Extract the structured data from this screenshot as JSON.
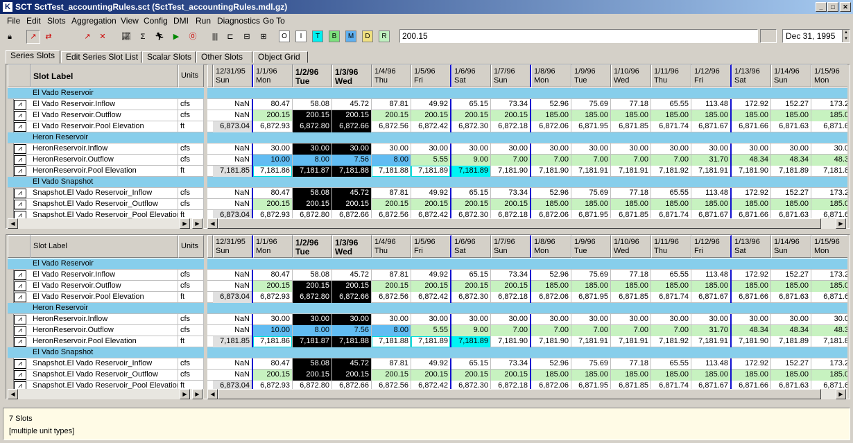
{
  "window": {
    "title": "SCT SctTest_accountingRules.sct (SctTest_accountingRules.mdl.gz)"
  },
  "menu": [
    "File",
    "Edit",
    "Slots",
    "Aggregation",
    "View",
    "Config",
    "DMI",
    "Run",
    "Diagnostics",
    "Go To"
  ],
  "flags": [
    "O",
    "I",
    "T",
    "B",
    "M",
    "D",
    "R"
  ],
  "value_field": "200.15",
  "date_field": "Dec 31, 1995",
  "tabs": [
    "Series Slots",
    "Edit Series Slot List",
    "Scalar Slots",
    "Other Slots",
    "Object Grid"
  ],
  "active_tab": "Series Slots",
  "grid": {
    "slot_label_header": "Slot Label",
    "units_header": "Units",
    "columns": [
      {
        "date": "12/31/95",
        "day": "Sun"
      },
      {
        "date": "1/1/96",
        "day": "Mon"
      },
      {
        "date": "1/2/96",
        "day": "Tue"
      },
      {
        "date": "1/3/96",
        "day": "Wed"
      },
      {
        "date": "1/4/96",
        "day": "Thu"
      },
      {
        "date": "1/5/96",
        "day": "Fri"
      },
      {
        "date": "1/6/96",
        "day": "Sat"
      },
      {
        "date": "1/7/96",
        "day": "Sun"
      },
      {
        "date": "1/8/96",
        "day": "Mon"
      },
      {
        "date": "1/9/96",
        "day": "Tue"
      },
      {
        "date": "1/10/96",
        "day": "Wed"
      },
      {
        "date": "1/11/96",
        "day": "Thu"
      },
      {
        "date": "1/12/96",
        "day": "Fri"
      },
      {
        "date": "1/13/96",
        "day": "Sat"
      },
      {
        "date": "1/14/96",
        "day": "Sun"
      },
      {
        "date": "1/15/96",
        "day": "Mon"
      }
    ],
    "rows": [
      {
        "type": "group",
        "label": "El Vado Reservoir"
      },
      {
        "type": "slot",
        "label": "El Vado Reservoir.Inflow",
        "units": "cfs",
        "values": [
          "NaN",
          "80.47",
          "58.08",
          "45.72",
          "87.81",
          "49.92",
          "65.15",
          "73.34",
          "52.96",
          "75.69",
          "77.18",
          "65.55",
          "113.48",
          "172.92",
          "152.27",
          "173.2"
        ],
        "styles": [
          "",
          "",
          "",
          "",
          "",
          "",
          "",
          "",
          "",
          "",
          "",
          "",
          "",
          "",
          "",
          ""
        ]
      },
      {
        "type": "slot",
        "label": "El Vado Reservoir.Outflow",
        "units": "cfs",
        "values": [
          "NaN",
          "200.15",
          "200.15",
          "200.15",
          "200.15",
          "200.15",
          "200.15",
          "200.15",
          "185.00",
          "185.00",
          "185.00",
          "185.00",
          "185.00",
          "185.00",
          "185.00",
          "185.0"
        ],
        "styles": [
          "",
          "g",
          "k",
          "k",
          "g",
          "g",
          "g",
          "g",
          "g",
          "g",
          "g",
          "g",
          "g",
          "g",
          "g",
          "g"
        ]
      },
      {
        "type": "slot",
        "label": "El Vado Reservoir.Pool Elevation",
        "units": "ft",
        "values": [
          "6,873.04",
          "6,872.93",
          "6,872.80",
          "6,872.66",
          "6,872.56",
          "6,872.42",
          "6,872.30",
          "6,872.18",
          "6,872.06",
          "6,871.95",
          "6,871.85",
          "6,871.74",
          "6,871.67",
          "6,871.66",
          "6,871.63",
          "6,871.6"
        ],
        "styles": [
          "h",
          "",
          "k",
          "k",
          "",
          "",
          "",
          "",
          "",
          "",
          "",
          "",
          "",
          "",
          "",
          ""
        ]
      },
      {
        "type": "group",
        "label": "Heron Reservoir"
      },
      {
        "type": "slot",
        "label": "HeronReservoir.Inflow",
        "units": "cfs",
        "values": [
          "NaN",
          "30.00",
          "30.00",
          "30.00",
          "30.00",
          "30.00",
          "30.00",
          "30.00",
          "30.00",
          "30.00",
          "30.00",
          "30.00",
          "30.00",
          "30.00",
          "30.00",
          "30.0"
        ],
        "styles": [
          "",
          "",
          "k",
          "k",
          "",
          "",
          "",
          "",
          "",
          "",
          "",
          "",
          "",
          "",
          "",
          ""
        ]
      },
      {
        "type": "slot",
        "label": "HeronReservoir.Outflow",
        "units": "cfs",
        "values": [
          "NaN",
          "10.00",
          "8.00",
          "7.56",
          "8.00",
          "5.55",
          "9.00",
          "7.00",
          "7.00",
          "7.00",
          "7.00",
          "7.00",
          "31.70",
          "48.34",
          "48.34",
          "48.3"
        ],
        "styles": [
          "",
          "b",
          "b",
          "b",
          "b",
          "g",
          "g",
          "g",
          "g",
          "g",
          "g",
          "g",
          "g",
          "g",
          "g",
          "g"
        ]
      },
      {
        "type": "slot",
        "label": "HeronReservoir.Pool Elevation",
        "units": "ft",
        "values": [
          "7,181.85",
          "7,181.86",
          "7,181.87",
          "7,181.88",
          "7,181.88",
          "7,181.89",
          "7,181.89",
          "7,181.90",
          "7,181.90",
          "7,181.91",
          "7,181.91",
          "7,181.92",
          "7,181.91",
          "7,181.90",
          "7,181.89",
          "7,181.8"
        ],
        "styles": [
          "h",
          "cx",
          "k",
          "k",
          "cx",
          "cx",
          "c",
          "",
          "",
          "",
          "",
          "",
          "",
          "",
          "",
          ""
        ]
      },
      {
        "type": "group",
        "label": "El Vado Snapshot"
      },
      {
        "type": "slot",
        "label": "Snapshot.El Vado Reservoir_Inflow",
        "units": "cfs",
        "values": [
          "NaN",
          "80.47",
          "58.08",
          "45.72",
          "87.81",
          "49.92",
          "65.15",
          "73.34",
          "52.96",
          "75.69",
          "77.18",
          "65.55",
          "113.48",
          "172.92",
          "152.27",
          "173.2"
        ],
        "styles": [
          "",
          "",
          "k",
          "k",
          "",
          "",
          "",
          "",
          "",
          "",
          "",
          "",
          "",
          "",
          "",
          ""
        ]
      },
      {
        "type": "slot",
        "label": "Snapshot.El Vado Reservoir_Outflow",
        "units": "cfs",
        "values": [
          "NaN",
          "200.15",
          "200.15",
          "200.15",
          "200.15",
          "200.15",
          "200.15",
          "200.15",
          "185.00",
          "185.00",
          "185.00",
          "185.00",
          "185.00",
          "185.00",
          "185.00",
          "185.0"
        ],
        "styles": [
          "",
          "g",
          "k",
          "k",
          "g",
          "g",
          "g",
          "g",
          "g",
          "g",
          "g",
          "g",
          "g",
          "g",
          "g",
          "g"
        ]
      },
      {
        "type": "slot",
        "label": "Snapshot.El Vado Reservoir_Pool Elevation",
        "units": "ft",
        "values": [
          "6,873.04",
          "6,872.93",
          "6,872.80",
          "6,872.66",
          "6,872.56",
          "6,872.42",
          "6,872.30",
          "6,872.18",
          "6,872.06",
          "6,871.95",
          "6,871.85",
          "6,871.74",
          "6,871.67",
          "6,871.66",
          "6,871.63",
          "6,871.6"
        ],
        "styles": [
          "h",
          "",
          "",
          "",
          "",
          "",
          "",
          "",
          "",
          "",
          "",
          "",
          "",
          "",
          "",
          ""
        ]
      }
    ]
  },
  "status": {
    "line1": "7 Slots",
    "line2": "[multiple unit types]"
  }
}
